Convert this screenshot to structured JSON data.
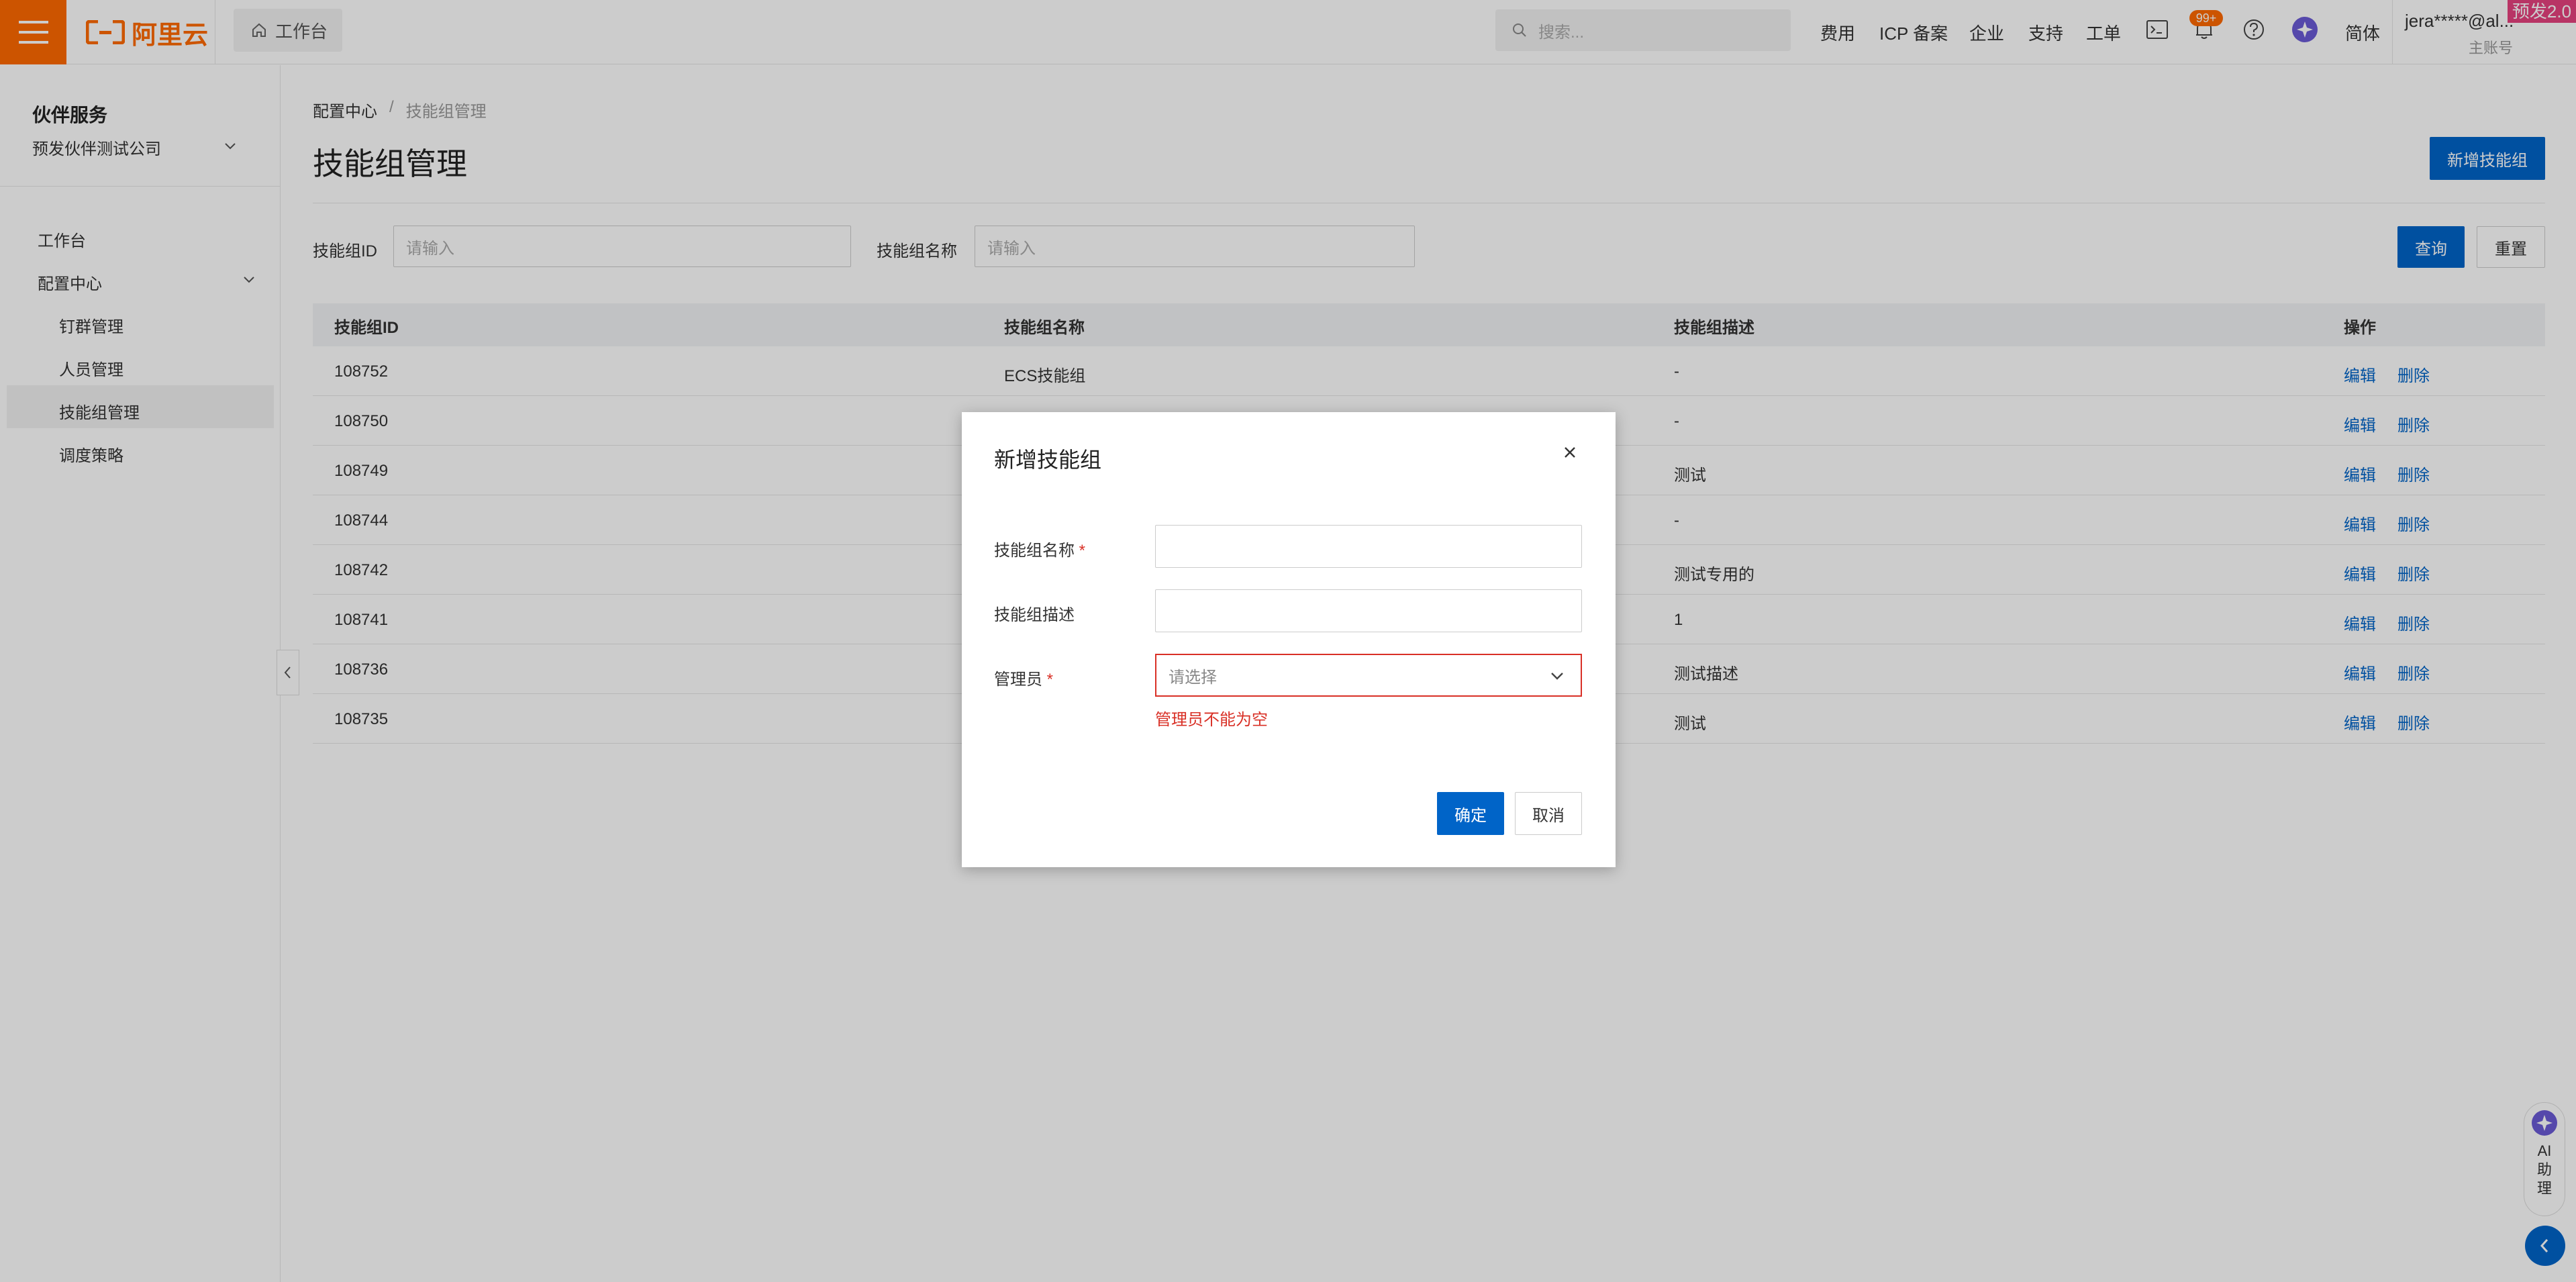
{
  "topbar": {
    "logo_text": "阿里云",
    "workbench_tab": "工作台",
    "search_placeholder": "搜索...",
    "nav_links": [
      "费用",
      "ICP 备案",
      "企业",
      "支持",
      "工单"
    ],
    "bell_badge": "99+",
    "language": "简体",
    "account_name": "jera*****@al...",
    "account_role": "主账号",
    "env_badge": "预发2.0",
    "brand_color": "#ff6a00"
  },
  "sidebar": {
    "title": "伙伴服务",
    "company": "预发伙伴测试公司",
    "items": [
      {
        "label": "工作台"
      },
      {
        "label": "配置中心"
      },
      {
        "label": "钉群管理"
      },
      {
        "label": "人员管理"
      },
      {
        "label": "技能组管理",
        "active": true
      },
      {
        "label": "调度策略"
      }
    ]
  },
  "main": {
    "breadcrumb": [
      "配置中心",
      "技能组管理"
    ],
    "breadcrumb_sep": "/",
    "page_title": "技能组管理",
    "add_button": "新增技能组",
    "filters": {
      "id_label": "技能组ID",
      "id_placeholder": "请输入",
      "name_label": "技能组名称",
      "name_placeholder": "请输入",
      "query_button": "查询",
      "reset_button": "重置"
    },
    "table": {
      "headers": [
        "技能组ID",
        "技能组名称",
        "技能组描述",
        "操作"
      ],
      "rows": [
        {
          "id": "108752",
          "name": "ECS技能组",
          "desc": "-"
        },
        {
          "id": "108750",
          "name": "",
          "desc": "-"
        },
        {
          "id": "108749",
          "name": "",
          "desc": "测试"
        },
        {
          "id": "108744",
          "name": "",
          "desc": "-"
        },
        {
          "id": "108742",
          "name": "",
          "desc": "测试专用的"
        },
        {
          "id": "108741",
          "name": "",
          "desc": "1"
        },
        {
          "id": "108736",
          "name": "",
          "desc": "测试描述"
        },
        {
          "id": "108735",
          "name": "",
          "desc": "测试"
        }
      ],
      "edit_label": "编辑",
      "delete_label": "删除"
    }
  },
  "ai_assistant": {
    "label": "AI助理"
  },
  "modal": {
    "title": "新增技能组",
    "name_label": "技能组名称",
    "desc_label": "技能组描述",
    "admin_label": "管理员",
    "required_mark": "*",
    "admin_placeholder": "请选择",
    "admin_error": "管理员不能为空",
    "confirm_button": "确定",
    "cancel_button": "取消",
    "primary_color": "#0064c8",
    "error_color": "#d93026"
  }
}
